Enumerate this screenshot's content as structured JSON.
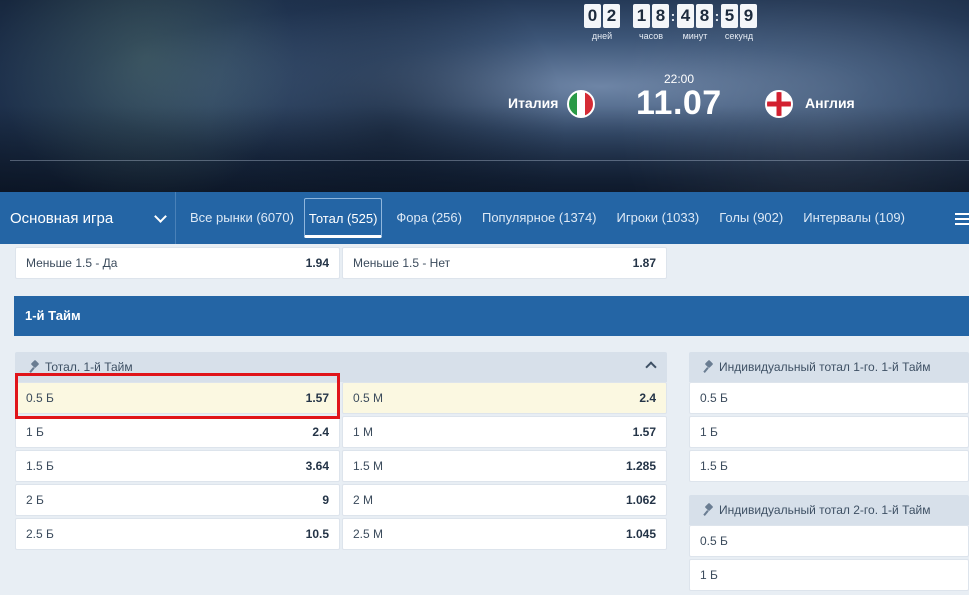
{
  "countdown": {
    "days": [
      "0",
      "2"
    ],
    "hours": [
      "1",
      "8"
    ],
    "minutes": [
      "4",
      "8"
    ],
    "seconds": [
      "5",
      "9"
    ],
    "labels": {
      "days": "дней",
      "hours": "часов",
      "minutes": "минут",
      "seconds": "секунд"
    },
    "separator": ":"
  },
  "match": {
    "time": "22:00",
    "date": "11.07",
    "home_team": "Италия",
    "away_team": "Англия",
    "home_flag_icon": "italy-flag-icon",
    "away_flag_icon": "england-flag-icon"
  },
  "nav": {
    "main_select": "Основная игра",
    "tabs": [
      {
        "label": "Все рынки",
        "count": "(6070)"
      },
      {
        "label": "Тотал",
        "count": "(525)"
      },
      {
        "label": "Фора",
        "count": "(256)"
      },
      {
        "label": "Популярное",
        "count": "(1374)"
      },
      {
        "label": "Игроки",
        "count": "(1033)"
      },
      {
        "label": "Голы",
        "count": "(902)"
      },
      {
        "label": "Интервалы",
        "count": "(109)"
      }
    ],
    "active_tab": "Тотал"
  },
  "top_row": [
    {
      "label": "Меньше 1.5 - Да",
      "odd": "1.94"
    },
    {
      "label": "Меньше 1.5 - Нет",
      "odd": "1.87"
    }
  ],
  "section": {
    "title": "1-й Тайм"
  },
  "total_panel": {
    "title": "Тотал. 1-й Тайм",
    "rows": [
      {
        "over_label": "0.5 Б",
        "over_odd": "1.57",
        "under_label": "0.5 М",
        "under_odd": "2.4"
      },
      {
        "over_label": "1 Б",
        "over_odd": "2.4",
        "under_label": "1 М",
        "under_odd": "1.57"
      },
      {
        "over_label": "1.5 Б",
        "over_odd": "3.64",
        "under_label": "1.5 М",
        "under_odd": "1.285"
      },
      {
        "over_label": "2 Б",
        "over_odd": "9",
        "under_label": "2 М",
        "under_odd": "1.062"
      },
      {
        "over_label": "2.5 Б",
        "over_odd": "10.5",
        "under_label": "2.5 М",
        "under_odd": "1.045"
      }
    ]
  },
  "ind_total_1": {
    "title": "Индивидуальный тотал 1-го. 1-й Тайм",
    "rows": [
      "0.5 Б",
      "1 Б",
      "1.5 Б"
    ]
  },
  "ind_total_2": {
    "title": "Индивидуальный тотал 2-го. 1-й Тайм",
    "rows": [
      "0.5 Б",
      "1 Б"
    ]
  },
  "colors": {
    "accent": "#2465a5",
    "highlight_border": "#e0141a",
    "selected_bg": "#fbf8e1"
  }
}
